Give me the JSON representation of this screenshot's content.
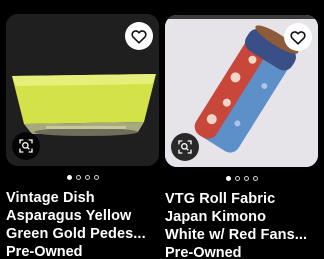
{
  "listings": [
    {
      "title_lines": [
        "Vintage Dish",
        "Asparagus Yellow",
        "Green Gold Pedes..."
      ],
      "condition": "Pre-Owned",
      "image_icon": "lens-search-icon",
      "favorite_icon": "heart-outline-icon",
      "carousel_dots": 4,
      "active_dot": 1
    },
    {
      "title_lines": [
        "VTG Roll Fabric",
        "Japan Kimono",
        "White w/ Red Fans..."
      ],
      "condition": "Pre-Owned",
      "image_icon": "lens-search-icon",
      "favorite_icon": "heart-outline-icon",
      "carousel_dots": 4,
      "active_dot": 1
    }
  ],
  "colors": {
    "background": "#000000",
    "dish_yellow": "#d4e24a",
    "fabric_red": "#c9463a",
    "fabric_blue": "#5d8fc9"
  }
}
